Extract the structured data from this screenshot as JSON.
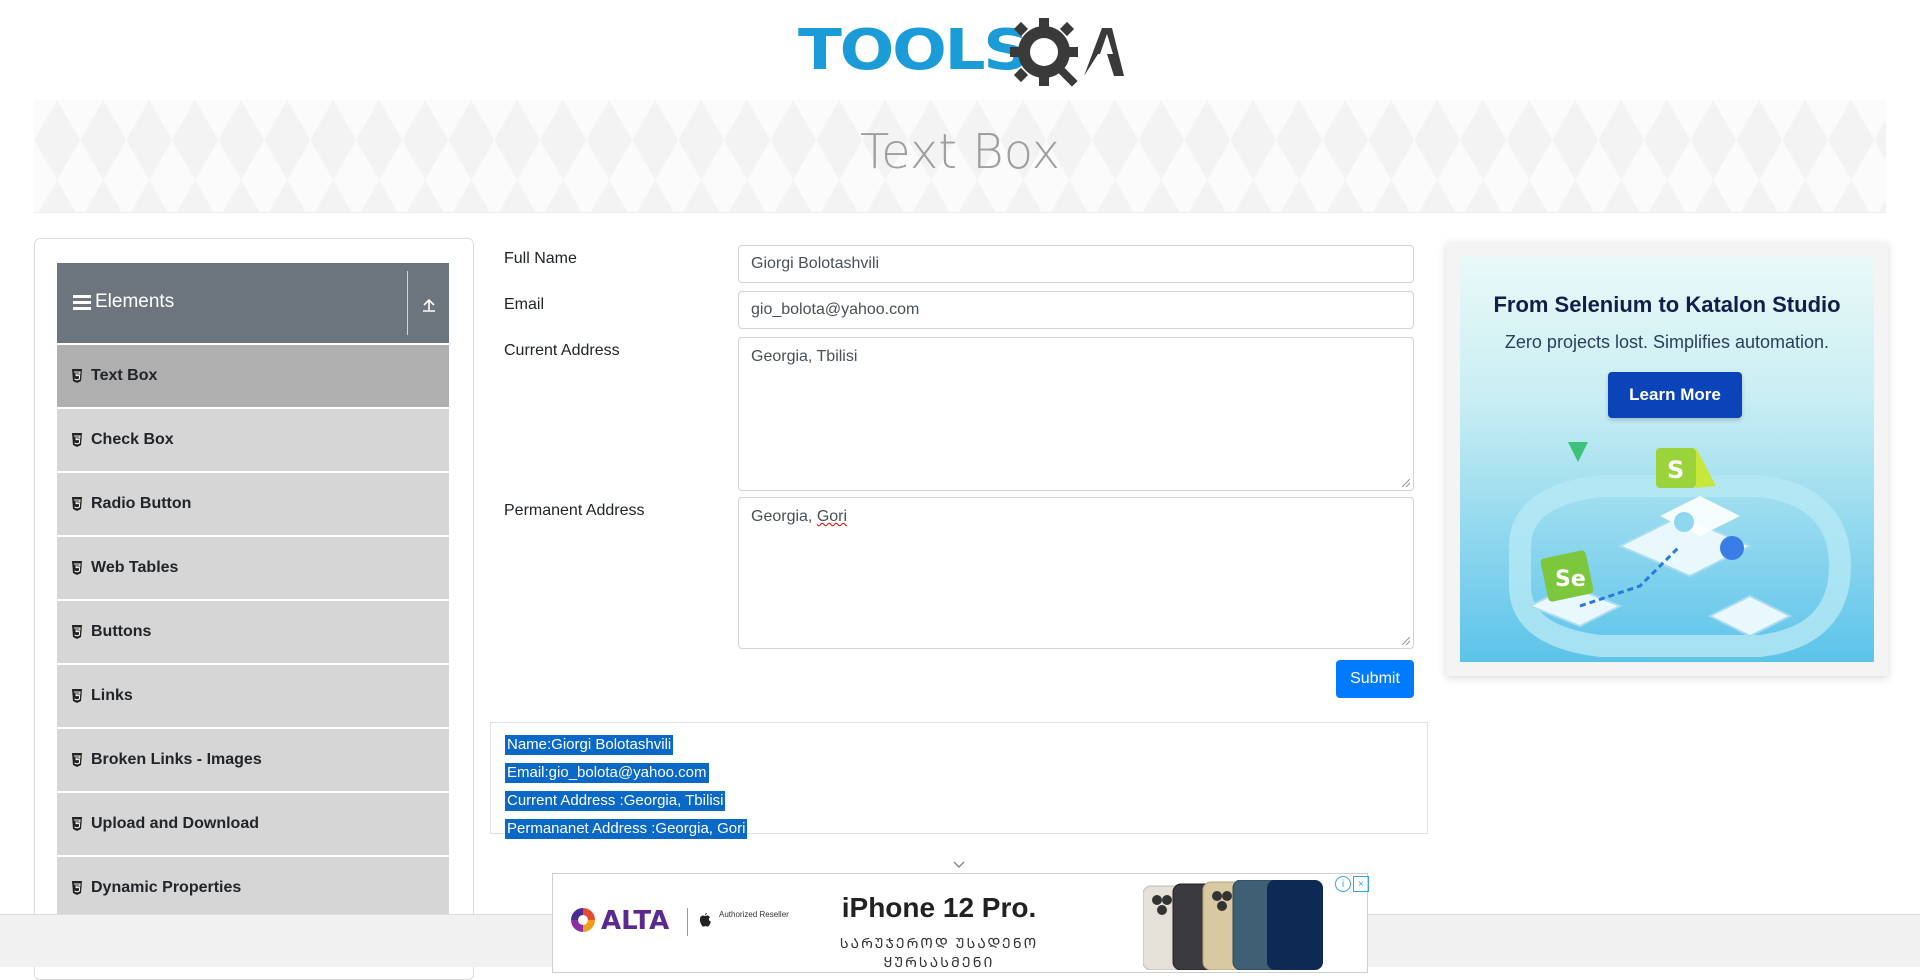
{
  "header": {
    "logo_text": "TOOLSQA",
    "logo_part1": "TOOLS",
    "logo_part2": "QA"
  },
  "banner": {
    "title": "Text Box"
  },
  "sidebar": {
    "group_title": "Elements",
    "items": [
      {
        "label": "Text Box",
        "active": true
      },
      {
        "label": "Check Box"
      },
      {
        "label": "Radio Button"
      },
      {
        "label": "Web Tables"
      },
      {
        "label": "Buttons"
      },
      {
        "label": "Links"
      },
      {
        "label": "Broken Links - Images"
      },
      {
        "label": "Upload and Download"
      },
      {
        "label": "Dynamic Properties"
      }
    ]
  },
  "form": {
    "full_name_label": "Full Name",
    "full_name_value": "Giorgi Bolotashvili",
    "email_label": "Email",
    "email_value": "gio_bolota@yahoo.com",
    "current_address_label": "Current Address",
    "current_address_value": "Georgia, Tbilisi",
    "permanent_address_label": "Permanent Address",
    "permanent_address_value_prefix": "Georgia, ",
    "permanent_address_value_word": "Gori",
    "submit_label": "Submit"
  },
  "output": {
    "name": "Name:Giorgi Bolotashvili",
    "email": "Email:gio_bolota@yahoo.com",
    "current_address": "Current Address :Georgia, Tbilisi",
    "permanent_address": "Permananet Address :Georgia, Gori"
  },
  "side_ad": {
    "title": "From Selenium to Katalon Studio",
    "subtitle": "Zero projects lost. Simplifies automation.",
    "button": "Learn More"
  },
  "bottom_ad": {
    "brand": "ALTA",
    "reseller": "Authorized Reseller",
    "title": "iPhone 12 Pro.",
    "subtitle": "ᲡᲐᲠᲣᲯᲔᲠᲝᲓ ᲣᲡᲐᲓᲔᲜᲝ ᲧᲣᲠᲡᲐᲡᲛᲔᲜᲘ"
  },
  "colors": {
    "primary": "#007bff",
    "sidebar_header": "#6c757d",
    "menu_item": "#d6d6d6",
    "menu_item_active": "#afafaf",
    "selection": "#0a68c6",
    "logo_blue": "#1b9bd7"
  },
  "icons": {
    "menu": "hamburger-icon",
    "collapse": "arrow-up-icon",
    "menu_item": "html5-icon",
    "scroll": "chevron-down-icon",
    "ad_info": "info-icon",
    "ad_close": "close-icon"
  }
}
